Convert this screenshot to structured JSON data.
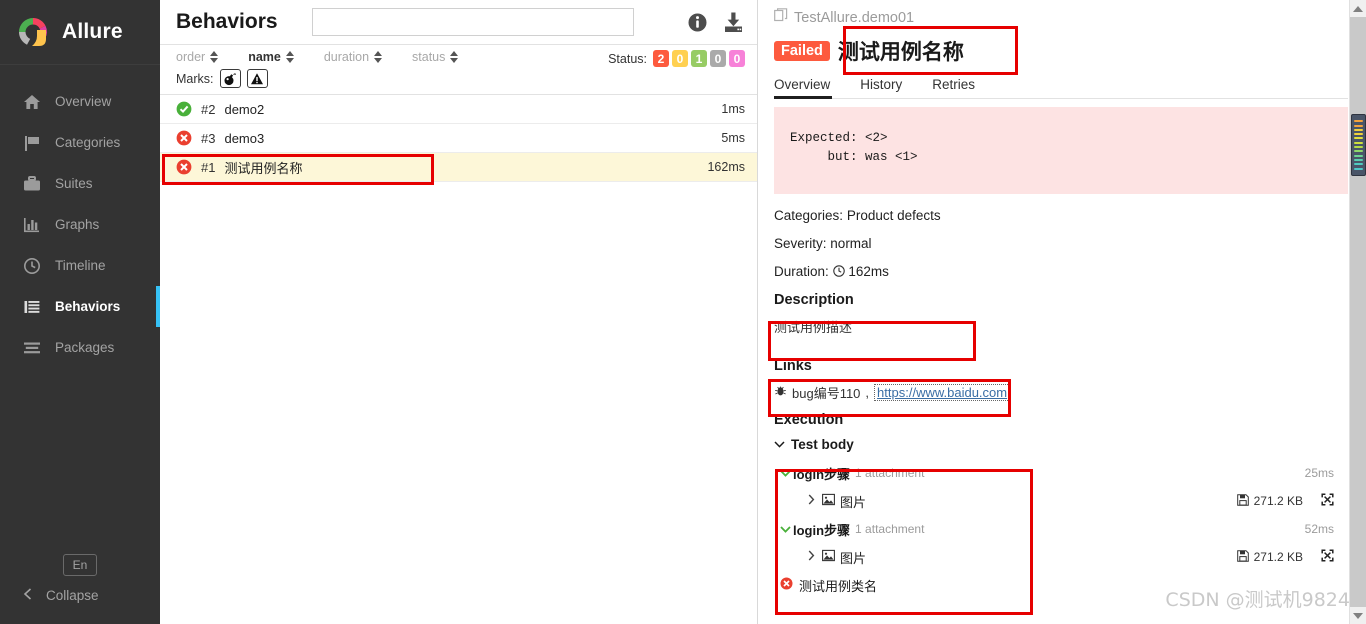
{
  "sidebar": {
    "brand": "Allure",
    "items": [
      {
        "label": "Overview",
        "icon": "home-icon"
      },
      {
        "label": "Categories",
        "icon": "flag-icon"
      },
      {
        "label": "Suites",
        "icon": "briefcase-icon"
      },
      {
        "label": "Graphs",
        "icon": "bar-chart-icon"
      },
      {
        "label": "Timeline",
        "icon": "clock-icon"
      },
      {
        "label": "Behaviors",
        "icon": "list-icon"
      },
      {
        "label": "Packages",
        "icon": "layers-icon"
      }
    ],
    "active_index": 5,
    "language": "En",
    "collapse": "Collapse"
  },
  "center": {
    "title": "Behaviors",
    "search_placeholder": "",
    "search_value": "",
    "info_icon": "info-icon",
    "download_icon": "download-icon",
    "sort": {
      "label_prefix": "",
      "items": [
        {
          "label": "order",
          "active": false
        },
        {
          "label": "name",
          "active": true
        },
        {
          "label": "duration",
          "active": false
        },
        {
          "label": "status",
          "active": false
        }
      ]
    },
    "status": {
      "label": "Status:",
      "counts": [
        {
          "value": "2",
          "color": "#fd5a3e",
          "name": "failed"
        },
        {
          "value": "0",
          "color": "#ffd050",
          "name": "broken"
        },
        {
          "value": "1",
          "color": "#97cc64",
          "name": "passed"
        },
        {
          "value": "0",
          "color": "#aaaaaa",
          "name": "skipped"
        },
        {
          "value": "0",
          "color": "#f781d8",
          "name": "unknown"
        }
      ]
    },
    "marks": {
      "label": "Marks:",
      "buttons": [
        {
          "icon": "bomb-icon",
          "glyph": "💣"
        },
        {
          "icon": "warning-triangle-icon",
          "glyph": "⚠"
        }
      ]
    },
    "rows": [
      {
        "status": "passed",
        "order": "#2",
        "name": "demo2",
        "duration": "1ms",
        "selected": false
      },
      {
        "status": "failed",
        "order": "#3",
        "name": "demo3",
        "duration": "5ms",
        "selected": false
      },
      {
        "status": "failed",
        "order": "#1",
        "name": "测试用例名称",
        "duration": "162ms",
        "selected": true
      }
    ]
  },
  "detail": {
    "breadcrumb": "TestAllure.demo01",
    "breadcrumb_icon": "copy-icon",
    "status_badge": "Failed",
    "title": "测试用例名称",
    "tabs": [
      {
        "label": "Overview",
        "active": true
      },
      {
        "label": "History",
        "active": false
      },
      {
        "label": "Retries",
        "active": false
      }
    ],
    "error_text": "Expected: <2>\n     but: was <1>",
    "meta": [
      {
        "label": "Categories:",
        "value": "Product defects"
      },
      {
        "label": "Severity:",
        "value": "normal"
      },
      {
        "label": "Duration:",
        "value": "162ms",
        "icon": "clock-icon"
      }
    ],
    "description_heading": "Description",
    "description_text": "测试用例描述",
    "links_heading": "Links",
    "link": {
      "icon": "bug-icon",
      "text": "bug编号110",
      "separator": ",",
      "url": "https://www.baidu.com"
    },
    "execution_heading": "Execution",
    "test_body_label": "Test body",
    "steps": [
      {
        "name": "login步骤",
        "attachment_label": "1 attachment",
        "time": "25ms",
        "status": "passed",
        "attachments": [
          {
            "name": "图片",
            "size": "271.2 KB",
            "icon": "image-file-icon",
            "expand_icon": "fullscreen-icon"
          }
        ]
      },
      {
        "name": "login步骤",
        "attachment_label": "1 attachment",
        "time": "52ms",
        "status": "passed",
        "attachments": [
          {
            "name": "图片",
            "size": "271.2 KB",
            "icon": "image-file-icon",
            "expand_icon": "fullscreen-icon"
          }
        ]
      }
    ],
    "failed_step": {
      "name": "测试用例类名",
      "status": "failed"
    }
  },
  "watermark": "CSDN @测试机9824",
  "colors": {
    "accent_blue": "#36c2f6",
    "failed": "#fd5a3e",
    "passed": "#49b03a",
    "highlight_red": "#e60000",
    "selected_row": "#fdf7d8",
    "error_bg": "#fde3e3"
  }
}
